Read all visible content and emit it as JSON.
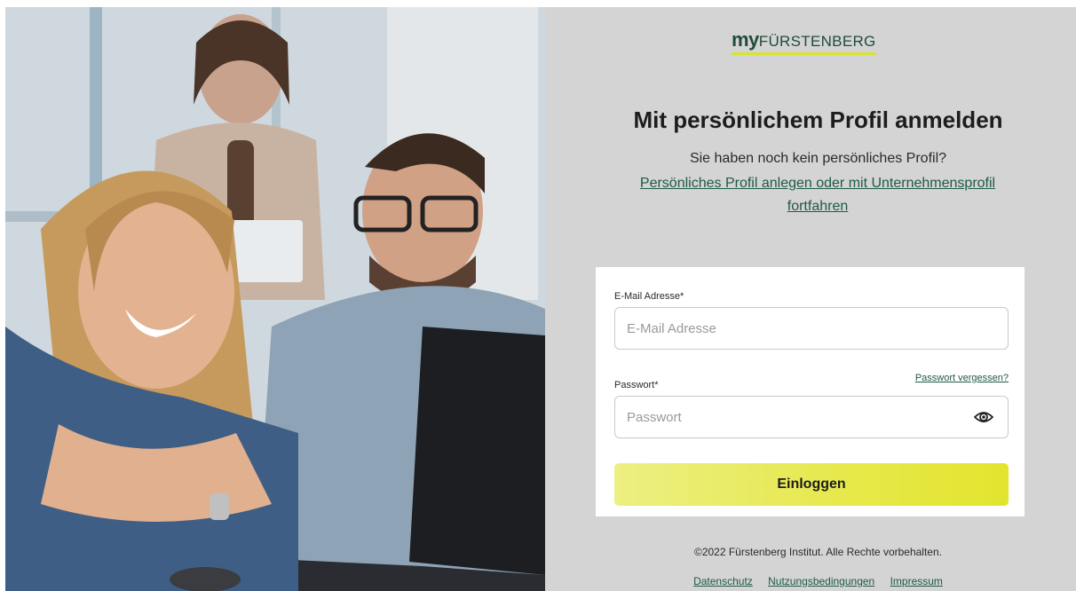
{
  "logo": {
    "prefix": "my",
    "name": "FÜRSTENBERG"
  },
  "heading": "Mit persönlichem Profil anmelden",
  "subtitle": "Sie haben noch kein persönliches Profil?",
  "register_link": "Persönliches Profil anlegen oder mit Unternehmensprofil fortfahren",
  "form": {
    "email_label": "E-Mail Adresse*",
    "email_placeholder": "E-Mail Adresse",
    "email_value": "",
    "password_label": "Passwort*",
    "password_placeholder": "Passwort",
    "password_value": "",
    "forgot_link": "Passwort vergessen?",
    "password_toggle_icon": "eye-icon",
    "submit_label": "Einloggen"
  },
  "footer": {
    "copyright": "©2022 Fürstenberg Institut. Alle Rechte vorbehalten.",
    "links": [
      "Datenschutz",
      "Nutzungsbedingungen",
      "Impressum"
    ]
  },
  "colors": {
    "brand_green": "#1f4d39",
    "accent_yellow": "#e2e52e",
    "panel_background": "#d4d4d4",
    "link": "#1f5a45"
  }
}
